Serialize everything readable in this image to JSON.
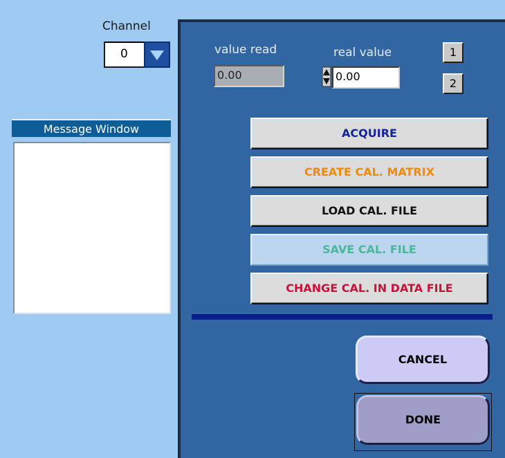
{
  "channel": {
    "label": "Channel",
    "value": "0"
  },
  "message_window": {
    "title": "Message Window"
  },
  "panel": {
    "value_read": {
      "label": "value read",
      "value": "0.00"
    },
    "real_value": {
      "label": "real value",
      "value": "0.00"
    },
    "buttons": {
      "one": "1",
      "two": "2",
      "acquire": "ACQUIRE",
      "create": "CREATE CAL. MATRIX",
      "load": "LOAD CAL. FILE",
      "save": "SAVE CAL. FILE",
      "change": "CHANGE CAL. IN DATA FILE",
      "cancel": "CANCEL",
      "done": "DONE"
    }
  },
  "colors": {
    "background": "#9fcaf2",
    "panel": "#3166a2",
    "acquire_text": "#13239c",
    "create_text": "#f08a00",
    "save_text": "#4bb79a",
    "change_text": "#c8123a",
    "divider": "#0a1d8c"
  },
  "icons": {
    "channel_dropdown": "chevron-down-icon",
    "spin": "up-down-arrows-icon"
  }
}
